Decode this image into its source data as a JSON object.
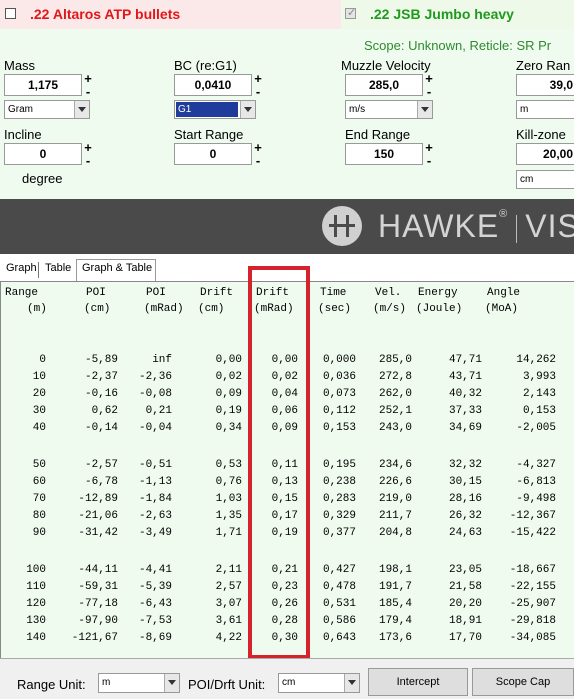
{
  "bullets": [
    {
      "name": ".22 Altaros ATP bullets",
      "checked": false,
      "color": "#e0181a"
    },
    {
      "name": ".22 JSB Jumbo heavy",
      "checked": true,
      "color": "#1f9a1f"
    }
  ],
  "scope_info": "Scope: Unknown, Reticle: SR Pr",
  "fields": {
    "mass": {
      "label": "Mass",
      "value": "1,175",
      "unit": "Gram"
    },
    "bc": {
      "label": "BC (re:G1)",
      "value": "0,0410",
      "unit": "G1"
    },
    "velocity": {
      "label": "Muzzle Velocity",
      "value": "285,0",
      "unit": "m/s"
    },
    "zero": {
      "label": "Zero Ran",
      "value": "39,0",
      "unit": "m"
    },
    "incline": {
      "label": "Incline",
      "value": "0",
      "unit": "degree"
    },
    "start_range": {
      "label": "Start Range",
      "value": "0"
    },
    "end_range": {
      "label": "End Range",
      "value": "150"
    },
    "killzone": {
      "label": "Kill-zone",
      "value": "20,00",
      "unit": "cm"
    }
  },
  "plus": "+",
  "minus": "-",
  "banner": {
    "brand": "HAWKE",
    "mark": "®",
    "product": "VISIO"
  },
  "tabs": [
    "Graph",
    "Table",
    "Graph & Table"
  ],
  "table": {
    "headers": [
      [
        "Range",
        "(m)"
      ],
      [
        "POI",
        "(cm)"
      ],
      [
        "POI",
        "(mRad)"
      ],
      [
        "Drift",
        "(cm)"
      ],
      [
        "Drift",
        "(mRad)"
      ],
      [
        "Time",
        "(sec)"
      ],
      [
        "Vel.",
        "(m/s)"
      ],
      [
        "Energy",
        "(Joule)"
      ],
      [
        "Angle",
        "(MoA)"
      ]
    ],
    "groups": [
      [
        [
          "0",
          "-5,89",
          "inf",
          "0,00",
          "0,00",
          "0,000",
          "285,0",
          "47,71",
          "14,262"
        ],
        [
          "10",
          "-2,37",
          "-2,36",
          "0,02",
          "0,02",
          "0,036",
          "272,8",
          "43,71",
          "3,993"
        ],
        [
          "20",
          "-0,16",
          "-0,08",
          "0,09",
          "0,04",
          "0,073",
          "262,0",
          "40,32",
          "2,143"
        ],
        [
          "30",
          "0,62",
          "0,21",
          "0,19",
          "0,06",
          "0,112",
          "252,1",
          "37,33",
          "0,153"
        ],
        [
          "40",
          "-0,14",
          "-0,04",
          "0,34",
          "0,09",
          "0,153",
          "243,0",
          "34,69",
          "-2,005"
        ]
      ],
      [
        [
          "50",
          "-2,57",
          "-0,51",
          "0,53",
          "0,11",
          "0,195",
          "234,6",
          "32,32",
          "-4,327"
        ],
        [
          "60",
          "-6,78",
          "-1,13",
          "0,76",
          "0,13",
          "0,238",
          "226,6",
          "30,15",
          "-6,813"
        ],
        [
          "70",
          "-12,89",
          "-1,84",
          "1,03",
          "0,15",
          "0,283",
          "219,0",
          "28,16",
          "-9,498"
        ],
        [
          "80",
          "-21,06",
          "-2,63",
          "1,35",
          "0,17",
          "0,329",
          "211,7",
          "26,32",
          "-12,367"
        ],
        [
          "90",
          "-31,42",
          "-3,49",
          "1,71",
          "0,19",
          "0,377",
          "204,8",
          "24,63",
          "-15,422"
        ]
      ],
      [
        [
          "100",
          "-44,11",
          "-4,41",
          "2,11",
          "0,21",
          "0,427",
          "198,1",
          "23,05",
          "-18,667"
        ],
        [
          "110",
          "-59,31",
          "-5,39",
          "2,57",
          "0,23",
          "0,478",
          "191,7",
          "21,58",
          "-22,155"
        ],
        [
          "120",
          "-77,18",
          "-6,43",
          "3,07",
          "0,26",
          "0,531",
          "185,4",
          "20,20",
          "-25,907"
        ],
        [
          "130",
          "-97,90",
          "-7,53",
          "3,61",
          "0,28",
          "0,586",
          "179,4",
          "18,91",
          "-29,818"
        ],
        [
          "140",
          "-121,67",
          "-8,69",
          "4,22",
          "0,30",
          "0,643",
          "173,6",
          "17,70",
          "-34,085"
        ]
      ]
    ]
  },
  "bottom": {
    "range_unit_label": "Range Unit:",
    "range_unit_value": "m",
    "poi_unit_label": "POI/Drft Unit:",
    "poi_unit_value": "cm",
    "intercept_button": "Intercept",
    "scopecap_button": "Scope Cap"
  },
  "colors": {
    "highlight": "#d4232c",
    "panel": "#f0fbf0",
    "banner": "#4a4a4a"
  }
}
